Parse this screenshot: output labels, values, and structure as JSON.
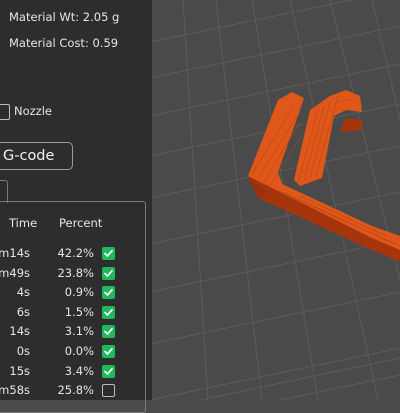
{
  "summary": {
    "material_wt": "Material Wt: 2.05 g",
    "material_cost": "Material Cost: 0.59"
  },
  "nozzle_label": "Nozzle",
  "gcode_button": "G-code",
  "table": {
    "headers": {
      "time": "Time",
      "percent": "Percent"
    },
    "rows": [
      {
        "time": "m14s",
        "percent": "42.2%",
        "visible": true
      },
      {
        "time": "m49s",
        "percent": "23.8%",
        "visible": true
      },
      {
        "time": "4s",
        "percent": "0.9%",
        "visible": true
      },
      {
        "time": "6s",
        "percent": "1.5%",
        "visible": true
      },
      {
        "time": "14s",
        "percent": "3.1%",
        "visible": true
      },
      {
        "time": "0s",
        "percent": "0.0%",
        "visible": true
      },
      {
        "time": "15s",
        "percent": "3.4%",
        "visible": true
      },
      {
        "time": "m58s",
        "percent": "25.8%",
        "visible": false
      }
    ]
  },
  "colors": {
    "panel_bg": "#2d2d2d",
    "viewport_bg": "#4a4a4a",
    "check_on": "#1fb85d",
    "model_orange": "#e0571a"
  }
}
